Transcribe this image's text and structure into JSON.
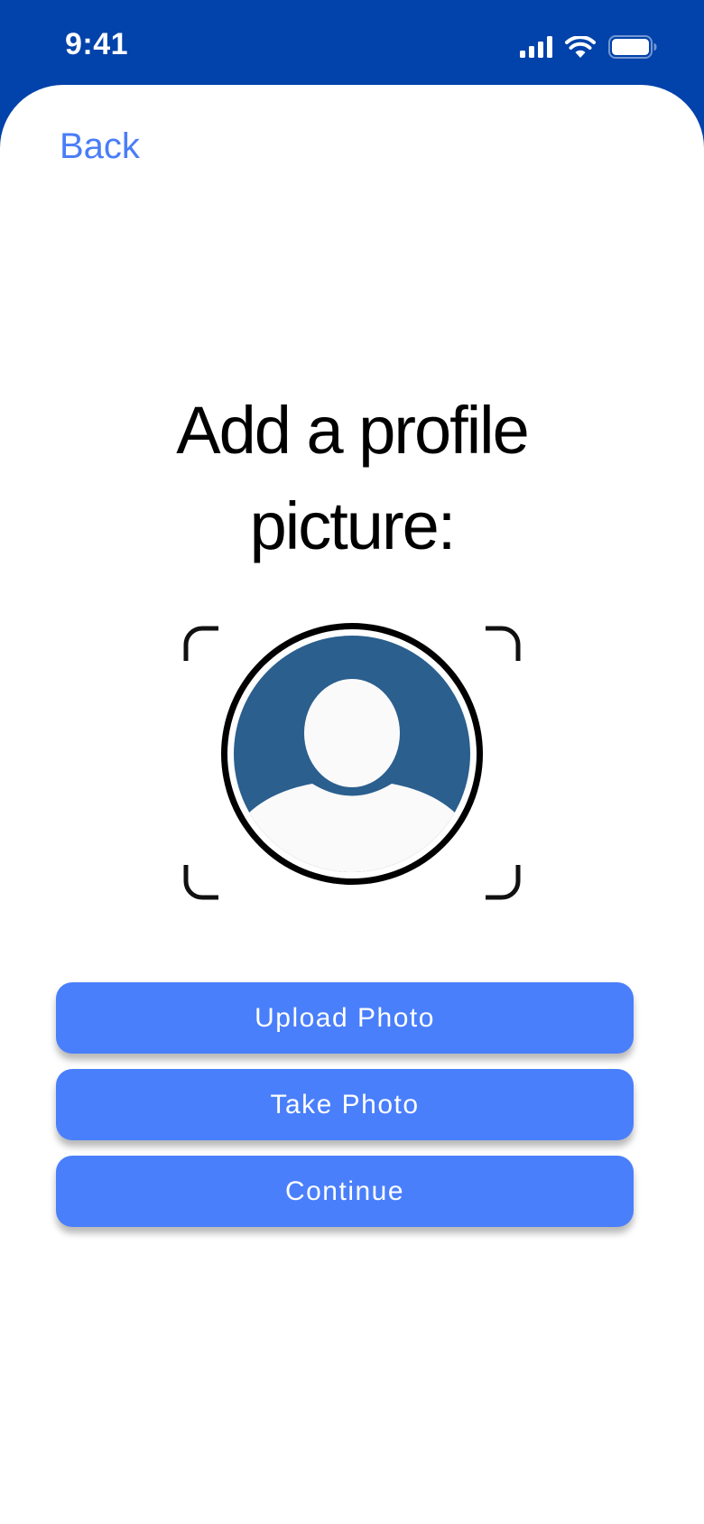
{
  "status_bar": {
    "time": "9:41",
    "icons": [
      "cellular-signal-icon",
      "wifi-icon",
      "battery-icon"
    ]
  },
  "nav": {
    "back_label": "Back"
  },
  "main": {
    "title": "Add a profile picture:",
    "avatar_icon": "profile-avatar-icon",
    "frame_icon": "camera-frame-corners-icon"
  },
  "actions": {
    "upload_label": "Upload Photo",
    "take_label": "Take Photo",
    "continue_label": "Continue"
  },
  "colors": {
    "header_background": "#0142AB",
    "accent": "#4A7FFB",
    "link": "#4A7DF7",
    "avatar_fill": "#2A5F8E",
    "avatar_figure": "#FAFAFA"
  }
}
